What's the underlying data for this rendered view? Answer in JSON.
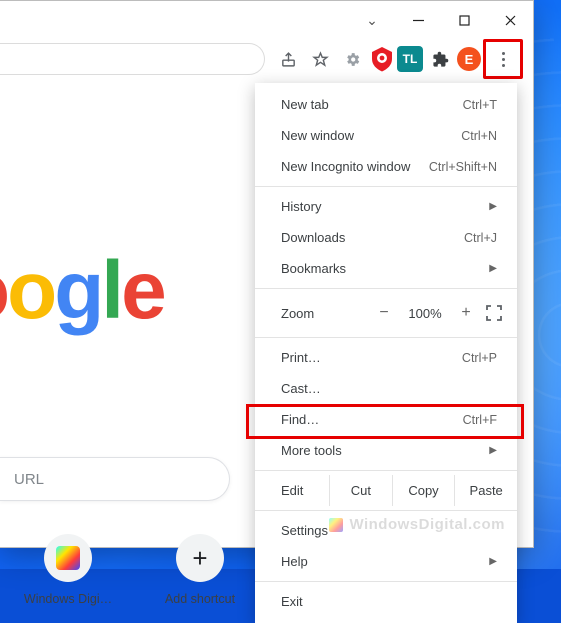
{
  "window": {
    "chevron": "⌄"
  },
  "toolbar": {
    "avatar_letter": "E",
    "ext_tl": "TL"
  },
  "logo": {
    "c1": "o",
    "c2": "o",
    "c3": "g",
    "c4": "l",
    "c5": "e"
  },
  "search": {
    "placeholder": "URL"
  },
  "shortcuts": [
    {
      "label": "Windows Digi…"
    },
    {
      "label": "Add shortcut"
    }
  ],
  "menu": {
    "new_tab": {
      "label": "New tab",
      "shortcut": "Ctrl+T"
    },
    "new_window": {
      "label": "New window",
      "shortcut": "Ctrl+N"
    },
    "incognito": {
      "label": "New Incognito window",
      "shortcut": "Ctrl+Shift+N"
    },
    "history": {
      "label": "History"
    },
    "downloads": {
      "label": "Downloads",
      "shortcut": "Ctrl+J"
    },
    "bookmarks": {
      "label": "Bookmarks"
    },
    "zoom": {
      "label": "Zoom",
      "minus": "−",
      "value": "100%",
      "plus": "+"
    },
    "print": {
      "label": "Print…",
      "shortcut": "Ctrl+P"
    },
    "cast": {
      "label": "Cast…"
    },
    "find": {
      "label": "Find…",
      "shortcut": "Ctrl+F"
    },
    "more_tools": {
      "label": "More tools"
    },
    "edit": {
      "label": "Edit",
      "cut": "Cut",
      "copy": "Copy",
      "paste": "Paste"
    },
    "settings": {
      "label": "Settings"
    },
    "help": {
      "label": "Help"
    },
    "exit": {
      "label": "Exit"
    }
  },
  "watermark": {
    "text": "WindowsDigital.com"
  }
}
